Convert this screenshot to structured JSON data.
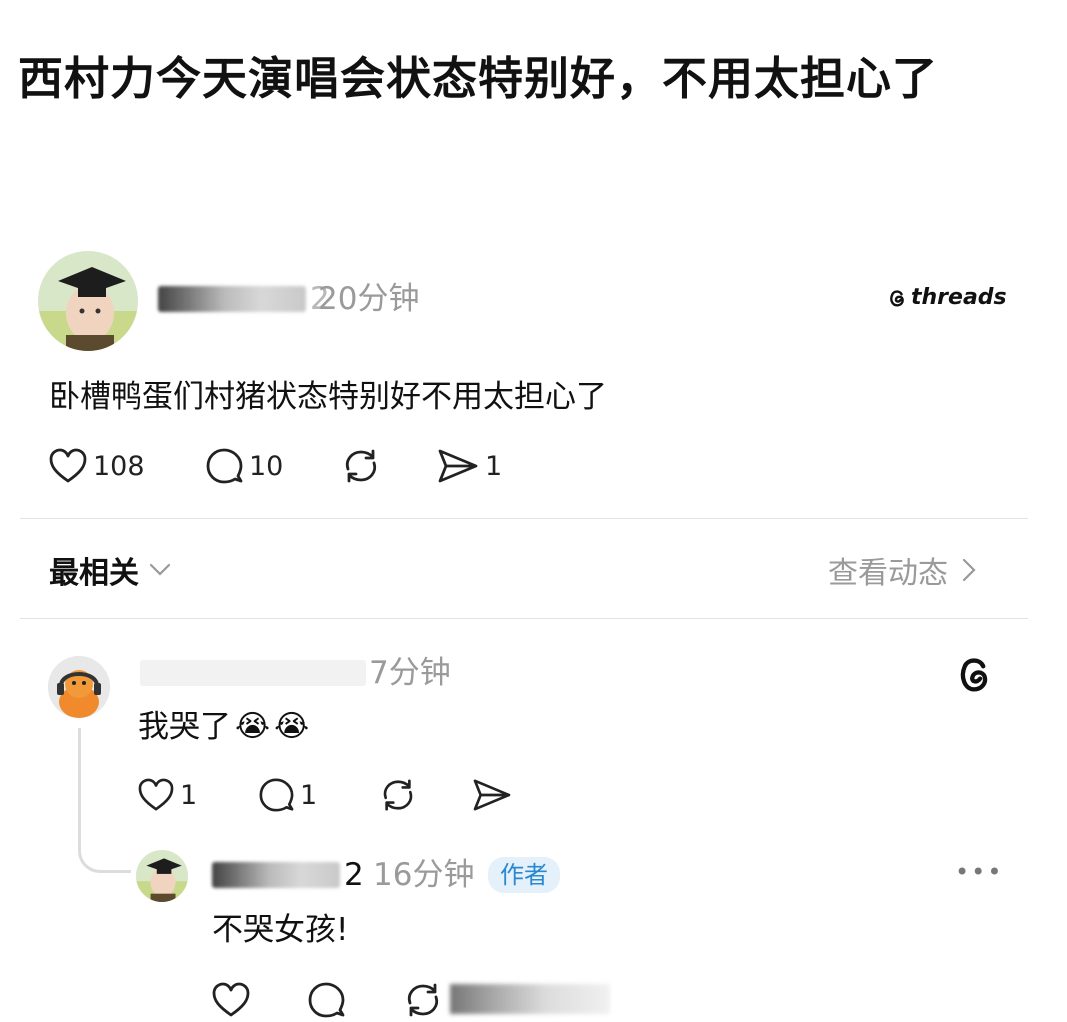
{
  "headline": "西村力今天演唱会状态特别好，不用太担心了",
  "post": {
    "username_tail": "2",
    "time": "20分钟",
    "brand": "threads",
    "text": "卧槽鸭蛋们村猪状态特别好不用太担心了",
    "likes": "108",
    "replies": "10",
    "shares": "1"
  },
  "sort": {
    "label": "最相关",
    "activity_label": "查看动态"
  },
  "comment": {
    "time": "7分钟",
    "text": "我哭了",
    "emoji": [
      "😭",
      "😭"
    ],
    "likes": "1",
    "replies": "1"
  },
  "reply": {
    "username_tail": "2",
    "time": "16分钟",
    "badge": "作者",
    "text": "不哭女孩!",
    "more": "•••"
  },
  "colors": {
    "text": "#111111",
    "muted": "#9a9a9a",
    "badge_bg": "#e4f1fb",
    "badge_text": "#2a88d0"
  }
}
